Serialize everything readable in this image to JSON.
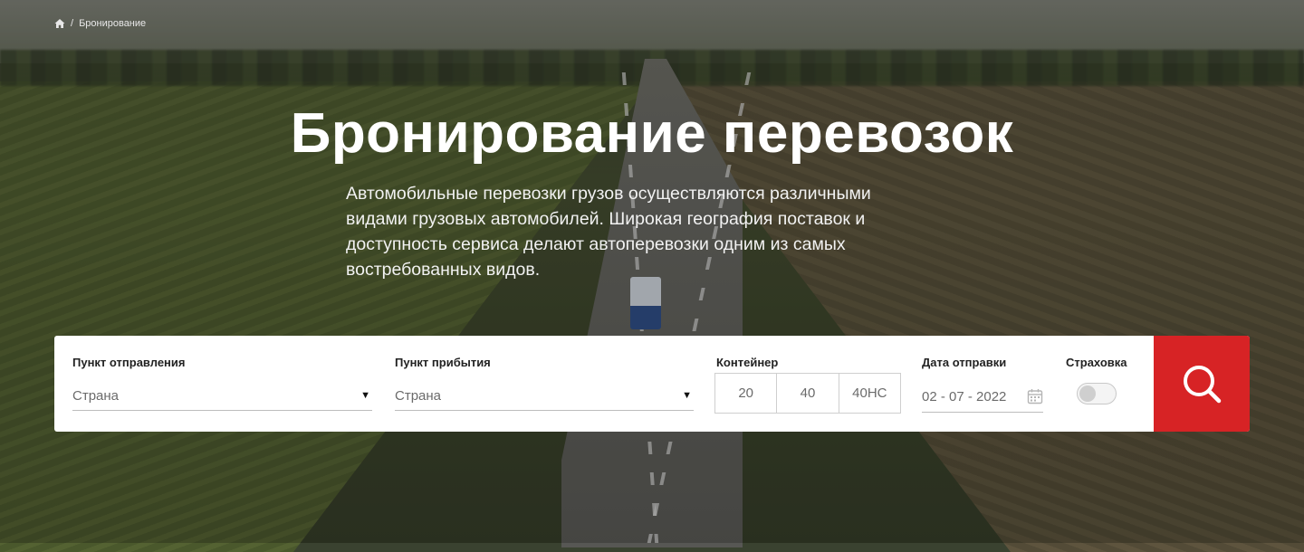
{
  "breadcrumb": {
    "separator": "/",
    "current": "Бронирование"
  },
  "hero": {
    "title": "Бронирование перевозок",
    "description": "Автомобильные перевозки грузов осуществляются различными видами грузовых автомобилей. Широкая география поставок и доступность сервиса делают автоперевозки одним из самых востребованных видов."
  },
  "search": {
    "departure": {
      "label": "Пункт отправления",
      "value": "Страна"
    },
    "arrival": {
      "label": "Пункт прибытия",
      "value": "Страна"
    },
    "container": {
      "label": "Контейнер",
      "options": [
        "20",
        "40",
        "40НС"
      ]
    },
    "date": {
      "label": "Дата отправки",
      "value": "02 - 07 - 2022"
    },
    "insurance": {
      "label": "Страховка",
      "enabled": false
    }
  },
  "icons": {
    "home": "home-icon",
    "caret": "chevron-down-icon",
    "calendar": "calendar-icon",
    "search": "search-icon"
  },
  "colors": {
    "accent": "#d72325",
    "panel": "#ffffff"
  }
}
